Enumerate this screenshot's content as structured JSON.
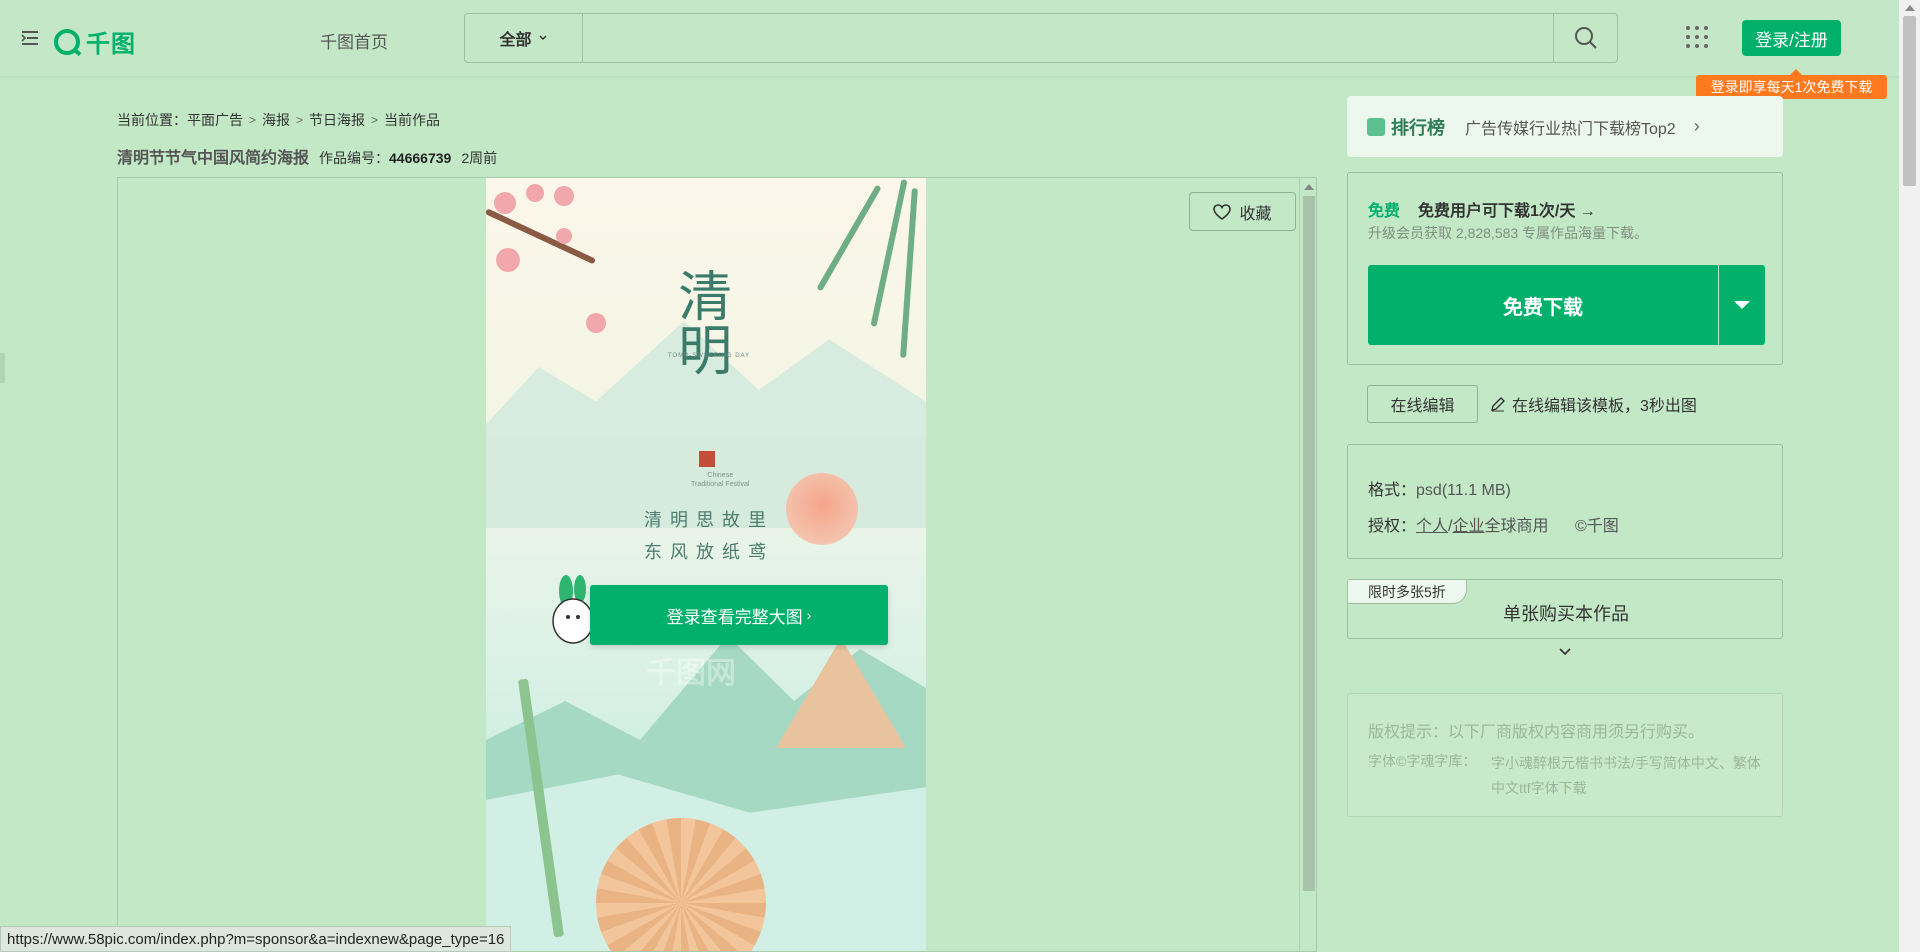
{
  "header": {
    "logo_text": "千图",
    "nav_home": "千图首页",
    "search": {
      "category": "全部",
      "placeholder": ""
    },
    "login_label": "登录/注册",
    "promo_tip": "登录即享每天1次免费下载"
  },
  "breadcrumb": {
    "prefix": "当前位置：",
    "items": [
      "平面广告",
      "海报",
      "节日海报",
      "当前作品"
    ]
  },
  "work": {
    "title": "清明节节气中国风简约海报",
    "id_label": "作品编号：",
    "id_value": "44666739",
    "time_ago": "2周前"
  },
  "preview": {
    "favorite_label": "收藏",
    "poster_title": "清明",
    "poster_en": "TOMB-SWEEPING DAY",
    "poster_sub_line1": "Chinese",
    "poster_sub_line2": "Traditional Festival",
    "poem_line1": "清明思故里",
    "poem_line2": "东风放纸鸢",
    "login_cta": "登录查看完整大图",
    "watermark": "千图网"
  },
  "sidebar": {
    "rank": {
      "label": "排行榜",
      "text": "广告传媒行业热门下载榜Top2"
    },
    "download": {
      "free_tag": "免费",
      "free_desc": "免费用户可下载1次/天 →",
      "free_sub": "升级会员获取 2,828,583 专属作品海量下载。",
      "button": "免费下载"
    },
    "edit": {
      "button": "在线编辑",
      "hint": "在线编辑该模板，3秒出图"
    },
    "info": {
      "format_key": "格式：",
      "format_value": "psd(11.1 MB)",
      "license_key": "授权：",
      "license_personal": "个人",
      "license_slash": "/",
      "license_enterprise": "企业",
      "license_scope": "全球商用",
      "license_copyright": "©千图"
    },
    "buy": {
      "tag": "限时多张5折",
      "text": "单张购买本作品"
    },
    "copyright": {
      "title": "版权提示：以下厂商版权内容商用须另行购买。",
      "font_key": "字体©字魂字库：",
      "font_value": "字小魂醉根元楷书书法/手写简体中文、繁体中文ttf字体下载"
    }
  },
  "status_bar": {
    "url": "https://www.58pic.com/index.php?m=sponsor&a=indexnew&page_type=16"
  },
  "colors": {
    "brand": "#00b06b",
    "promo": "#ff7a1f",
    "background": "#c3e8c6"
  }
}
